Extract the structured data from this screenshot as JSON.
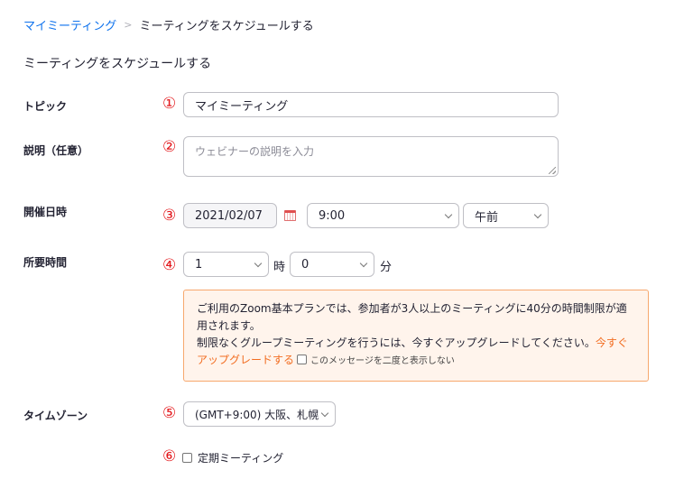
{
  "breadcrumb": {
    "link": "マイミーティング",
    "separator": ">",
    "current": "ミーティングをスケジュールする"
  },
  "page_title": "ミーティングをスケジュールする",
  "form": {
    "topic": {
      "label": "トピック",
      "number": "①",
      "value": "マイミーティング"
    },
    "description": {
      "label": "説明（任意）",
      "number": "②",
      "placeholder": "ウェビナーの説明を入力"
    },
    "datetime": {
      "label": "開催日時",
      "number": "③",
      "date": "2021/02/07",
      "time": "9:00",
      "ampm": "午前"
    },
    "duration": {
      "label": "所要時間",
      "number": "④",
      "hours": "1",
      "hours_unit": "時",
      "minutes": "0",
      "minutes_unit": "分"
    },
    "notice": {
      "line1": "ご利用のZoom基本プランでは、参加者が3人以上のミーティングに40分の時間制限が適用されます。",
      "line2": "制限なくグループミーティングを行うには、今すぐアップグレードしてください。",
      "upgrade_link": "今すぐアップグレードする",
      "dont_show": "このメッセージを二度と表示しない"
    },
    "timezone": {
      "label": "タイムゾーン",
      "number": "⑤",
      "value": "(GMT+9:00) 大阪、札幌、"
    },
    "recurring": {
      "number": "⑥",
      "label": "定期ミーティング"
    }
  },
  "colors": {
    "accent": "#0e72ed",
    "number_red": "#e3171b",
    "notice_bg": "#fff4ec",
    "notice_border": "#f7a86e",
    "link_orange": "#f26d21"
  }
}
